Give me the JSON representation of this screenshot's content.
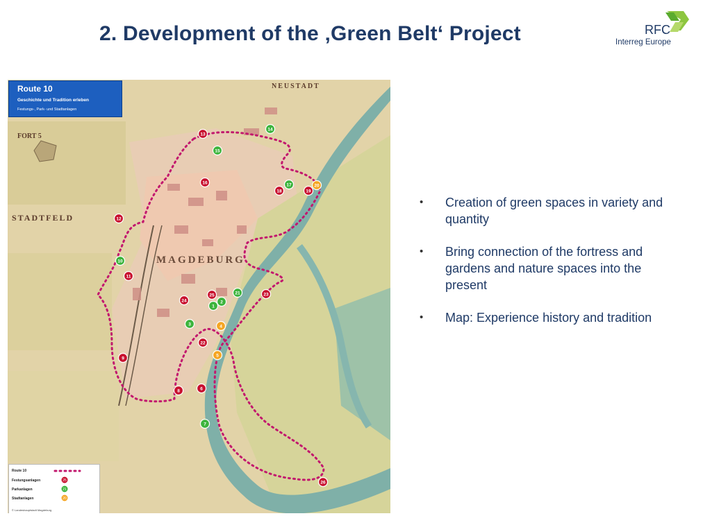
{
  "slide": {
    "title": "2. Development of the ‚Green Belt‘ Project"
  },
  "logo": {
    "name": "RFC",
    "subtitle": "Interreg Europe",
    "colors": [
      "#8dc63f",
      "#5aab2e",
      "#b5d96a"
    ]
  },
  "bullets": [
    {
      "text": "Creation of green spaces in variety and quantity"
    },
    {
      "text": "Bring connection of the fortress and gardens and nature spaces into the present"
    },
    {
      "text": "Map: Experience history and tradition"
    }
  ],
  "bullet_symbol": "•",
  "map": {
    "route_box": {
      "title": "Route 10",
      "line1": "Geschichte und Tradition erleben",
      "line2": "Festungs-, Park- und Stadtanlagen"
    },
    "place_labels": [
      "STADTFELD",
      "MAGDEBURG",
      "FORT 5",
      "NEUSTADT"
    ],
    "legend": {
      "rows": [
        "Route 10",
        "Festungsanlagen",
        "Parkanlagen",
        "Stadtanlagen"
      ],
      "marker_numbers": [
        "25",
        "21",
        "20"
      ],
      "footer": "© Landeshauptstadt Magdeburg"
    },
    "marker_colors": {
      "red": "#c8102e",
      "green": "#3cb43c",
      "orange": "#f5a623",
      "route": "#c2186e",
      "river": "#7fb0a8"
    },
    "markers": [
      {
        "n": "1",
        "type": "green"
      },
      {
        "n": "2",
        "type": "green"
      },
      {
        "n": "3",
        "type": "green"
      },
      {
        "n": "4",
        "type": "orange"
      },
      {
        "n": "5",
        "type": "orange"
      },
      {
        "n": "6",
        "type": "red"
      },
      {
        "n": "7",
        "type": "green"
      },
      {
        "n": "8",
        "type": "red"
      },
      {
        "n": "9",
        "type": "red"
      },
      {
        "n": "10",
        "type": "green"
      },
      {
        "n": "11",
        "type": "red"
      },
      {
        "n": "12",
        "type": "red"
      },
      {
        "n": "13",
        "type": "red"
      },
      {
        "n": "14",
        "type": "green"
      },
      {
        "n": "15",
        "type": "green"
      },
      {
        "n": "16",
        "type": "red"
      },
      {
        "n": "17",
        "type": "green"
      },
      {
        "n": "18",
        "type": "red"
      },
      {
        "n": "19",
        "type": "red"
      },
      {
        "n": "20",
        "type": "orange"
      },
      {
        "n": "21",
        "type": "green"
      },
      {
        "n": "22",
        "type": "red"
      },
      {
        "n": "23",
        "type": "red"
      },
      {
        "n": "24",
        "type": "red"
      },
      {
        "n": "25",
        "type": "red"
      },
      {
        "n": "26",
        "type": "red"
      }
    ]
  }
}
